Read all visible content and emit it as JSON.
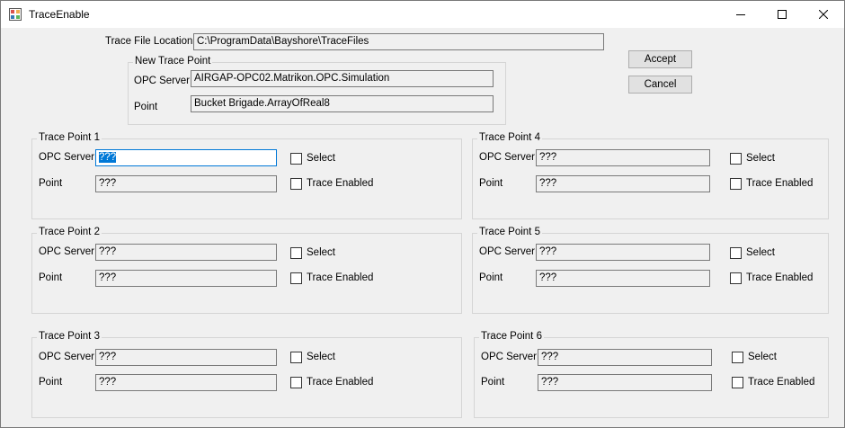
{
  "window": {
    "title": "TraceEnable"
  },
  "trace_file": {
    "label": "Trace File Location",
    "value": "C:\\ProgramData\\Bayshore\\TraceFiles"
  },
  "new_trace_point": {
    "title": "New Trace Point",
    "server_label": "OPC Server",
    "server_value": "AIRGAP-OPC02.Matrikon.OPC.Simulation",
    "point_label": "Point",
    "point_value": "Bucket Brigade.ArrayOfReal8"
  },
  "buttons": {
    "accept": "Accept",
    "cancel": "Cancel"
  },
  "trace_points": [
    {
      "title": "Trace Point 1",
      "server_label": "OPC Server",
      "server_value": "???",
      "point_label": "Point",
      "point_value": "???",
      "select_label": "Select",
      "select_checked": false,
      "enabled_label": "Trace Enabled",
      "enabled_checked": false
    },
    {
      "title": "Trace Point 2",
      "server_label": "OPC Server",
      "server_value": "???",
      "point_label": "Point",
      "point_value": "???",
      "select_label": "Select",
      "select_checked": false,
      "enabled_label": "Trace Enabled",
      "enabled_checked": false
    },
    {
      "title": "Trace Point 3",
      "server_label": "OPC Server",
      "server_value": "???",
      "point_label": "Point",
      "point_value": "???",
      "select_label": "Select",
      "select_checked": false,
      "enabled_label": "Trace Enabled",
      "enabled_checked": false
    },
    {
      "title": "Trace Point 4",
      "server_label": "OPC Server",
      "server_value": "???",
      "point_label": "Point",
      "point_value": "???",
      "select_label": "Select",
      "select_checked": false,
      "enabled_label": "Trace Enabled",
      "enabled_checked": false
    },
    {
      "title": "Trace Point 5",
      "server_label": "OPC Server",
      "server_value": "???",
      "point_label": "Point",
      "point_value": "???",
      "select_label": "Select",
      "select_checked": false,
      "enabled_label": "Trace Enabled",
      "enabled_checked": false
    },
    {
      "title": "Trace Point 6",
      "server_label": "OPC Server",
      "server_value": "???",
      "point_label": "Point",
      "point_value": "???",
      "select_label": "Select",
      "select_checked": false,
      "enabled_label": "Trace Enabled",
      "enabled_checked": false
    }
  ]
}
